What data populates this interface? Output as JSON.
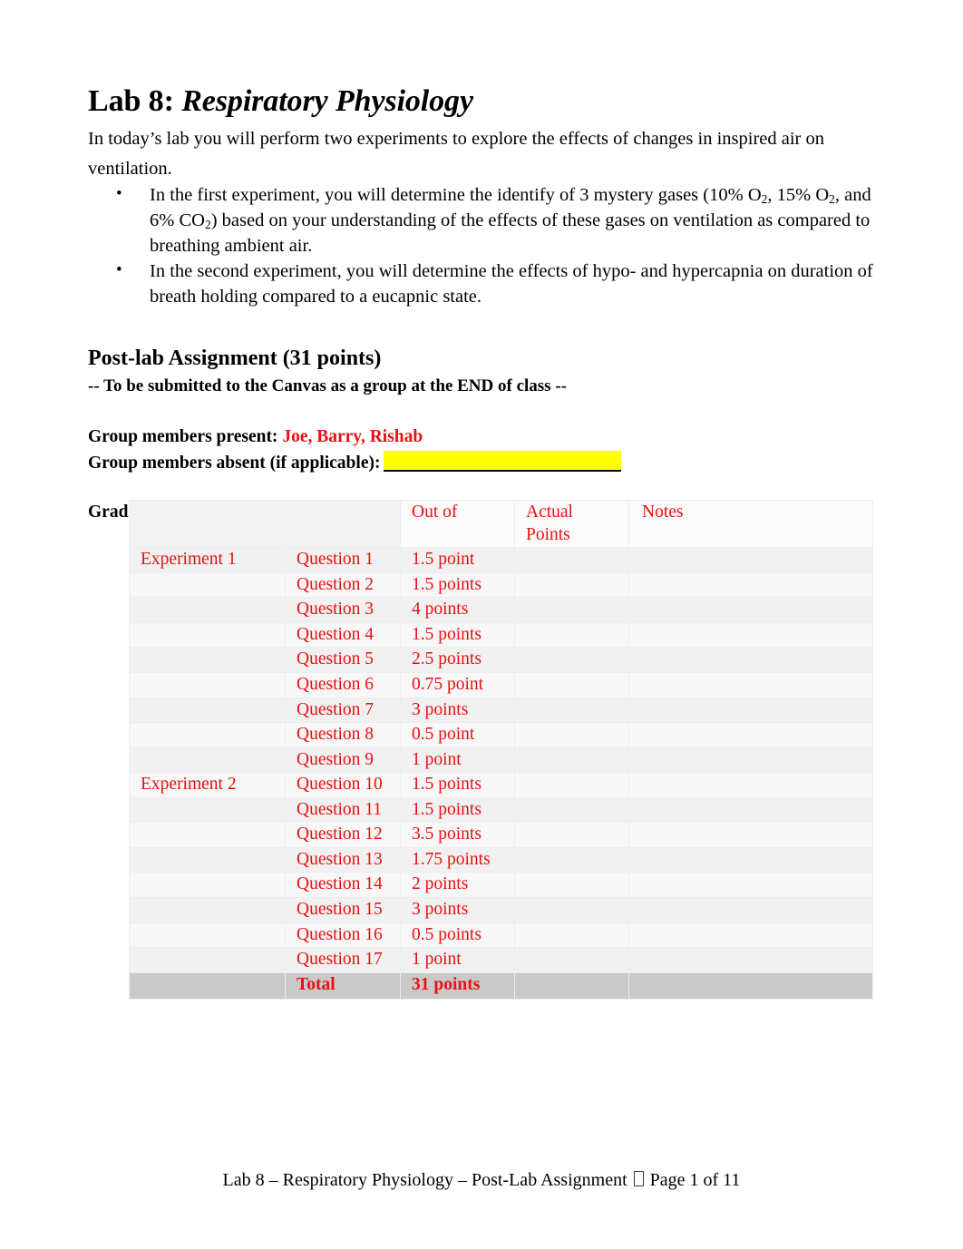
{
  "document": {
    "title_prefix": "Lab 8: ",
    "title_italic": "Respiratory Physiology",
    "intro": "In today’s lab you will perform two experiments to explore the effects of changes in inspired air on ventilation.",
    "bullets": [
      "In the first experiment, you will determine the identify of 3 mystery gases (10% O₂, 15% O₂, and 6% CO₂) based on your understanding of the effects of these gases on ventilation as compared to breathing ambient air.",
      "In the second experiment, you will determine the effects of hypo- and hypercapnia on duration of breath holding compared to a eucapnic state."
    ]
  },
  "postlab": {
    "heading": "Post-lab Assignment (31 points)",
    "subheading": "-- To be submitted to the Canvas as a group at the END of class --"
  },
  "group": {
    "present_label": "Group members present:",
    "present_value": "Joe, Barry, Rishab",
    "absent_label": "Group members absent (if applicable):",
    "absent_value": ""
  },
  "grading": {
    "label": "Grading template (for TA/Instructor use)",
    "headers": [
      "",
      "",
      "Out of",
      "Actual Points",
      "Notes"
    ],
    "header_col3": "Out of",
    "header_col4_line1": "Actual",
    "header_col4_line2": "Points",
    "header_col5": "Notes",
    "rows": [
      {
        "experiment": "Experiment 1",
        "question": "Question 1",
        "out_of": "1.5 point",
        "actual": "",
        "notes": ""
      },
      {
        "experiment": "",
        "question": "Question 2",
        "out_of": "1.5 points",
        "actual": "",
        "notes": ""
      },
      {
        "experiment": "",
        "question": "Question 3",
        "out_of": "4 points",
        "actual": "",
        "notes": ""
      },
      {
        "experiment": "",
        "question": "Question 4",
        "out_of": "1.5 points",
        "actual": "",
        "notes": ""
      },
      {
        "experiment": "",
        "question": "Question 5",
        "out_of": "2.5 points",
        "actual": "",
        "notes": ""
      },
      {
        "experiment": "",
        "question": "Question 6",
        "out_of": "0.75 point",
        "actual": "",
        "notes": ""
      },
      {
        "experiment": "",
        "question": "Question 7",
        "out_of": "3 points",
        "actual": "",
        "notes": ""
      },
      {
        "experiment": "",
        "question": "Question 8",
        "out_of": "0.5  point",
        "actual": "",
        "notes": ""
      },
      {
        "experiment": "",
        "question": "Question 9",
        "out_of": "1 point",
        "actual": "",
        "notes": ""
      },
      {
        "experiment": "Experiment 2",
        "question": "Question 10",
        "out_of": "1.5 points",
        "actual": "",
        "notes": ""
      },
      {
        "experiment": "",
        "question": "Question 11",
        "out_of": "1.5 points",
        "actual": "",
        "notes": ""
      },
      {
        "experiment": "",
        "question": "Question 12",
        "out_of": "3.5 points",
        "actual": "",
        "notes": ""
      },
      {
        "experiment": "",
        "question": "Question 13",
        "out_of": "1.75 points",
        "actual": "",
        "notes": ""
      },
      {
        "experiment": "",
        "question": "Question 14",
        "out_of": "2 points",
        "actual": "",
        "notes": ""
      },
      {
        "experiment": "",
        "question": "Question 15",
        "out_of": "3 points",
        "actual": "",
        "notes": ""
      },
      {
        "experiment": "",
        "question": "Question 16",
        "out_of": "0.5 points",
        "actual": "",
        "notes": ""
      },
      {
        "experiment": "",
        "question": "Question 17",
        "out_of": "1 point",
        "actual": "",
        "notes": ""
      }
    ],
    "total_row": {
      "experiment": "",
      "question": "Total",
      "out_of": "31 points",
      "actual": "",
      "notes": ""
    }
  },
  "footer": {
    "left_text": "Lab 8 – Respiratory Physiology – Post-Lab Assignment ",
    "page_text": " Page 1 of 11"
  },
  "colors": {
    "accent_red": "#E81010",
    "highlight_yellow": "#FFFF00",
    "total_row_bg": "#C9C9C9"
  }
}
